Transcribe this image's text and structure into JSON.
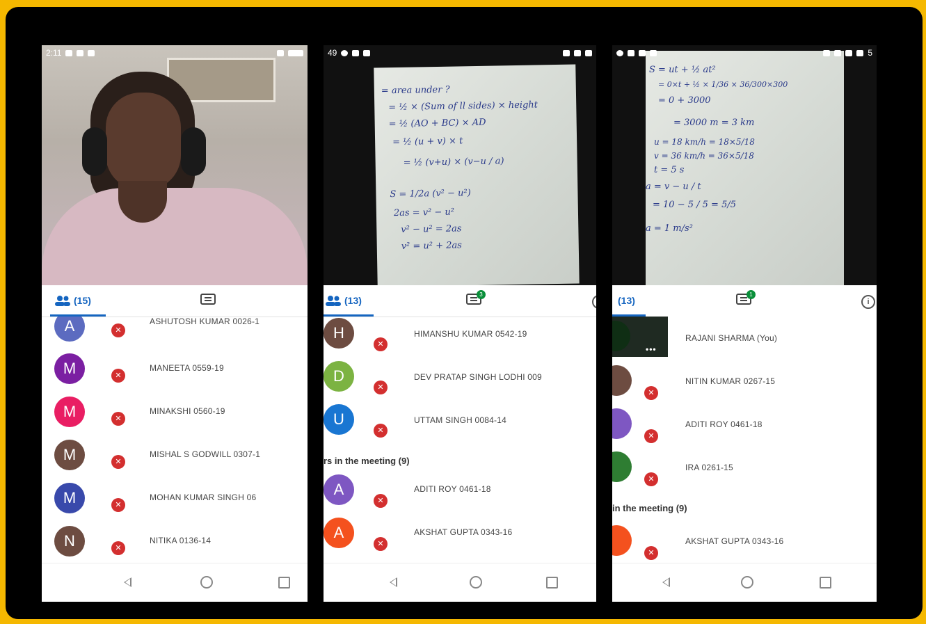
{
  "phones": [
    {
      "status": {
        "time": "2:11"
      },
      "tabs": {
        "participants_label": "(15)"
      },
      "participants": [
        {
          "initial": "A",
          "color": "#5c6bc0",
          "name": "ASHUTOSH KUMAR 0026-1"
        },
        {
          "initial": "M",
          "color": "#7b1fa2",
          "name": "MANEETA 0559-19"
        },
        {
          "initial": "M",
          "color": "#e91e63",
          "name": "MINAKSHI 0560-19"
        },
        {
          "initial": "M",
          "color": "#6d4c41",
          "name": "MISHAL S GODWILL 0307-1"
        },
        {
          "initial": "M",
          "color": "#3949ab",
          "name": "MOHAN KUMAR SINGH 06"
        },
        {
          "initial": "N",
          "color": "#6d4c41",
          "name": "NITIKA 0136-14"
        }
      ]
    },
    {
      "status": {
        "time": "49"
      },
      "tabs": {
        "participants_label": "(13)",
        "chat_badge": "3"
      },
      "participants": [
        {
          "initial": "H",
          "color": "#6d4c41",
          "name": "HIMANSHU KUMAR 0542-19"
        },
        {
          "initial": "D",
          "color": "#7cb342",
          "name": "DEV PRATAP SINGH LODHI 009"
        },
        {
          "initial": "U",
          "color": "#1976d2",
          "name": "UTTAM SINGH 0084-14"
        }
      ],
      "section_label": "rs in the meeting (9)",
      "participants_after": [
        {
          "initial": "A",
          "color": "#7e57c2",
          "name": "ADITI ROY 0461-18"
        },
        {
          "initial": "A",
          "color": "#f4511e",
          "name": "AKSHAT GUPTA 0343-16"
        }
      ],
      "board_lines": [
        "= area under ? ",
        "= ½ × (Sum of ll sides) × height",
        "= ½ (AO + BC) × AD",
        "= ½ (u + v) × t",
        "= ½ (v+u) × (v−u / a)",
        "S = 1/2a (v² − u²)",
        "2as = v² − u²",
        "v² − u² = 2as",
        "v² = u² + 2as"
      ]
    },
    {
      "status": {
        "right_text": "5"
      },
      "tabs": {
        "participants_label": "(13)",
        "chat_badge": "1"
      },
      "participants": [
        {
          "initial": "",
          "color": "#1b5e20",
          "name": "RAJANI SHARMA (You)"
        },
        {
          "initial": "",
          "color": "#6d4c41",
          "name": "NITIN KUMAR 0267-15"
        },
        {
          "initial": "",
          "color": "#7e57c2",
          "name": "ADITI ROY 0461-18"
        },
        {
          "initial": "",
          "color": "#2e7d32",
          "name": "IRA 0261-15"
        }
      ],
      "section_label": "in the meeting (9)",
      "participants_after": [
        {
          "initial": "",
          "color": "#f4511e",
          "name": "AKSHAT GUPTA 0343-16"
        }
      ],
      "board_lines": [
        "S = ut + ½ at²",
        "= 0×t + ½ × 1/36 × 36/300×300",
        "= 0 + 3000",
        "= 3000 m = 3 km",
        "u = 18 km/h = 18×5/18",
        "v = 36 km/h = 36×5/18",
        "t = 5 s",
        "a = v − u / t",
        "= 10 − 5 / 5 = 5/5",
        "a = 1 m/s²"
      ]
    }
  ],
  "nav": {
    "back": "◁",
    "home": "○",
    "recent": "□"
  },
  "colors": {
    "accent": "#1565c0",
    "frame": "#f5b800",
    "muted_mic": "#d32f2f"
  },
  "icons": {
    "participants": "people-icon",
    "chat": "chat-icon",
    "mic_off": "mic-off-icon",
    "info": "info-icon"
  }
}
